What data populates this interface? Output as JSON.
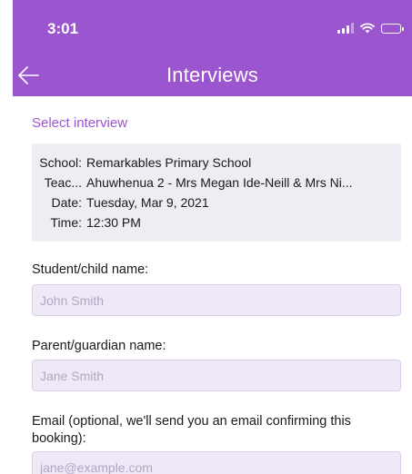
{
  "status_bar": {
    "time": "3:01"
  },
  "header": {
    "title": "Interviews",
    "back_icon": "arrow-left-icon",
    "background_color": "#9b55cf"
  },
  "select_interview_link": "Select interview",
  "interview": {
    "school_label": "School:",
    "school_value": "Remarkables Primary School",
    "teacher_label": "Teac...",
    "teacher_value": "Ahuwhenua 2 - Mrs Megan Ide-Neill & Mrs Ni...",
    "date_label": "Date:",
    "date_value": "Tuesday, Mar 9, 2021",
    "time_label": "Time:",
    "time_value": "12:30 PM"
  },
  "form": {
    "student_label": "Student/child name:",
    "student_placeholder": "John Smith",
    "parent_label": "Parent/guardian name:",
    "parent_placeholder": "Jane Smith",
    "email_label": "Email (optional, we'll send you an email confirming this booking):",
    "email_placeholder": "jane@example.com"
  }
}
